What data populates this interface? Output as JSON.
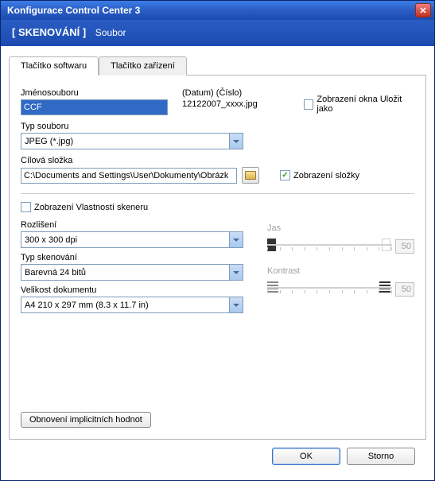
{
  "window": {
    "title": "Konfigurace Control Center 3"
  },
  "subheader": {
    "section": "[  SKENOVÁNÍ  ]",
    "page": "Soubor"
  },
  "tabs": {
    "software": "Tlačítko softwaru",
    "device": "Tlačítko zařízení"
  },
  "filename": {
    "label": "Jménosouboru",
    "value": "CCF"
  },
  "pattern": {
    "label": "(Datum)   (Číslo)",
    "value": "12122007_xxxx.jpg"
  },
  "saveas_checkbox": "Zobrazení okna Uložit jako",
  "filetype": {
    "label": "Typ souboru",
    "value": "JPEG (*.jpg)"
  },
  "target_folder": {
    "label": "Cílová složka",
    "value": "C:\\Documents and Settings\\User\\Dokumenty\\Obrázk"
  },
  "show_folder_checkbox": "Zobrazení složky",
  "scanner_props_checkbox": "Zobrazení Vlastností skeneru",
  "resolution": {
    "label": "Rozlišení",
    "value": "300 x 300 dpi"
  },
  "scantype": {
    "label": "Typ skenování",
    "value": "Barevná 24 bitů"
  },
  "docsize": {
    "label": "Velikost dokumentu",
    "value": "A4 210 x 297 mm (8.3 x 11.7 in)"
  },
  "brightness": {
    "label": "Jas",
    "value": "50"
  },
  "contrast": {
    "label": "Kontrast",
    "value": "50"
  },
  "restore_defaults": "Obnovení implicitních hodnot",
  "buttons": {
    "ok": "OK",
    "cancel": "Storno"
  }
}
